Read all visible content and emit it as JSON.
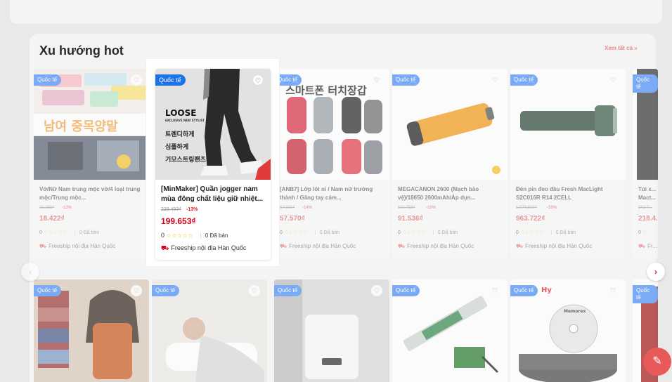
{
  "section": {
    "title": "Xu hướng hot",
    "see_all": "Xem tất cả »"
  },
  "badge_label": "Quốc tế",
  "focus_product": {
    "name": "[MinMaker] Quần jogger nam mùa đông chất liệu giữ nhiệt...",
    "old_price": "229.493₫",
    "discount": "-13%",
    "price": "199.653₫",
    "rating": "0",
    "stars": "☆☆☆☆☆",
    "sold": "0 Đã bán",
    "shipping": "Freeship nội địa Hàn Quốc",
    "image_text": {
      "line1": "LOOSE",
      "line2": "EXCLUSIVE NEW STYLIST",
      "line3": "트렌디하게",
      "line4": "심플하게",
      "line5": "기모스트링팬츠"
    }
  },
  "products": [
    {
      "name": "Vớ/Nữ Nam trung mộc vớ/4 loại trung mộc/Trung mộc...",
      "old_price": "21.183₫",
      "discount": "-13%",
      "price": "18.422₫",
      "rating": "0",
      "stars": "☆☆☆☆☆",
      "sold": "0 Đã bán",
      "shipping": "Freeship nội địa Hàn Quốc",
      "image_text": "남여 중목양말"
    },
    {
      "name": "[ANB7] Lớp lót nỉ / Nam nữ trưởng thành / Găng tay cảm...",
      "old_price": "67.000₫",
      "discount": "-14%",
      "price": "57.570₫",
      "rating": "0",
      "stars": "☆☆☆☆☆",
      "sold": "0 Đã bán",
      "shipping": "Freeship nội địa Hàn Quốc",
      "image_text": "스마트폰 터치장갑"
    },
    {
      "name": "MEGACANON 2600 (Mạch bảo vệ)/18650 2600mAh/Áp dụn...",
      "old_price": "101.753₫",
      "discount": "-10%",
      "price": "91.536₫",
      "rating": "0",
      "stars": "☆☆☆☆☆",
      "sold": "0 Đã bán",
      "shipping": "Freeship nội địa Hàn Quốc"
    },
    {
      "name": "Đèn pin đeo đầu Fresh MacLight S2C016R R14 2CELL",
      "old_price": "1.070.803₫",
      "discount": "-10%",
      "price": "963.722₫",
      "rating": "0",
      "stars": "☆☆☆☆☆",
      "sold": "0 Đã bán",
      "shipping": "Freeship nội địa Hàn Quốc"
    },
    {
      "name": "Túi x... Mact...",
      "old_price": "242.7...",
      "discount": "",
      "price": "218.4...",
      "rating": "0",
      "stars": "☆",
      "sold": "",
      "shipping": "Fr..."
    }
  ],
  "row2_image_text": {
    "item5": "Hy",
    "item6": "Memorex"
  },
  "colors": {
    "badge": "#1a73e8",
    "price": "#d0011b",
    "accent": "#e02020"
  }
}
